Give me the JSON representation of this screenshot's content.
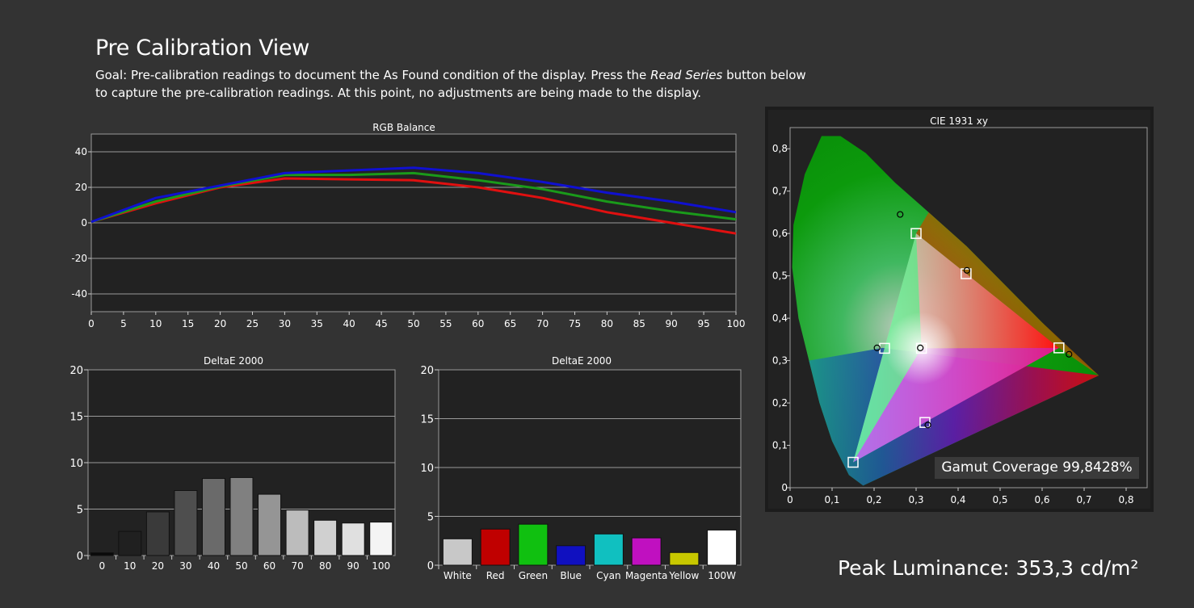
{
  "page": {
    "title": "Pre Calibration View",
    "goal_prefix": "Goal: Pre-calibration readings to document the As Found condition of the display. Press the ",
    "goal_emphasis": "Read Series",
    "goal_suffix": " button below to capture the pre-calibration readings. At this point, no adjustments are being made to the display.",
    "peak_luminance": "Peak Luminance: 353,3 cd/m²",
    "gamut_coverage": "Gamut Coverage 99,8428%"
  },
  "colors": {
    "background": "#333333",
    "plot_bg": "#222222",
    "red": "#e01010",
    "green": "#1a9a1a",
    "blue": "#1010d0"
  },
  "chart_data": [
    {
      "type": "line",
      "title": "RGB Balance",
      "x": [
        0,
        10,
        20,
        30,
        40,
        50,
        60,
        70,
        80,
        90,
        100
      ],
      "xticks": [
        "0",
        "5",
        "10",
        "15",
        "20",
        "25",
        "30",
        "35",
        "40",
        "45",
        "50",
        "55",
        "60",
        "65",
        "70",
        "75",
        "80",
        "85",
        "90",
        "95",
        "100"
      ],
      "yticks": [
        "40",
        "20",
        "0",
        "-20",
        "-40"
      ],
      "ylim": [
        -50,
        50
      ],
      "xlim": [
        0,
        100
      ],
      "grid": true,
      "series": [
        {
          "color": "#e01010",
          "values": [
            0.5,
            11,
            20,
            25,
            24.5,
            24,
            20,
            14,
            6,
            0,
            -6
          ]
        },
        {
          "color": "#1a9a1a",
          "values": [
            0.5,
            12,
            20.5,
            27,
            27,
            28,
            24,
            19,
            12,
            6.5,
            2
          ]
        },
        {
          "color": "#1010d0",
          "values": [
            0.5,
            14,
            21,
            28,
            29.5,
            31,
            28,
            23,
            17,
            12,
            6
          ]
        }
      ]
    },
    {
      "type": "bar",
      "title": "DeltaE 2000",
      "categories": [
        "0",
        "10",
        "20",
        "30",
        "40",
        "50",
        "60",
        "70",
        "80",
        "90",
        "100"
      ],
      "values": [
        0.3,
        2.6,
        4.7,
        7.0,
        8.3,
        8.4,
        6.6,
        4.9,
        3.8,
        3.5,
        3.6
      ],
      "colors": [
        "#0a0a0a",
        "#202020",
        "#3a3a3a",
        "#4e4e4e",
        "#6a6a6a",
        "#808080",
        "#959595",
        "#bcbcbc",
        "#d0d0d0",
        "#e0e0e0",
        "#f4f4f4"
      ],
      "yticks": [
        "20",
        "15",
        "10",
        "5",
        "0"
      ],
      "ylim": [
        0,
        20
      ],
      "grid": true
    },
    {
      "type": "bar",
      "title": "DeltaE 2000",
      "categories": [
        "White",
        "Red",
        "Green",
        "Blue",
        "Cyan",
        "Magenta",
        "Yellow",
        "100W"
      ],
      "values": [
        2.7,
        3.7,
        4.2,
        2.0,
        3.2,
        2.8,
        1.3,
        3.6
      ],
      "colors": [
        "#c8c8c8",
        "#c00000",
        "#10c010",
        "#1010c0",
        "#10c0c0",
        "#c010c0",
        "#c8c800",
        "#ffffff"
      ],
      "yticks": [
        "20",
        "15",
        "10",
        "5",
        "0"
      ],
      "ylim": [
        0,
        20
      ],
      "grid": true
    },
    {
      "type": "scatter",
      "title": "CIE 1931 xy",
      "xlim": [
        0,
        0.85
      ],
      "ylim": [
        0,
        0.85
      ],
      "xticks": [
        "0",
        "0,1",
        "0,2",
        "0,3",
        "0,4",
        "0,5",
        "0,6",
        "0,7",
        "0,8"
      ],
      "yticks": [
        "0",
        "0,1",
        "0,2",
        "0,3",
        "0,4",
        "0,5",
        "0,6",
        "0,7",
        "0,8"
      ],
      "target_gamut": {
        "red": [
          0.64,
          0.33
        ],
        "green": [
          0.3,
          0.6
        ],
        "blue": [
          0.15,
          0.06
        ]
      },
      "targets": [
        [
          0.64,
          0.33
        ],
        [
          0.3,
          0.6
        ],
        [
          0.15,
          0.06
        ],
        [
          0.225,
          0.329
        ],
        [
          0.321,
          0.154
        ],
        [
          0.419,
          0.505
        ],
        [
          0.3127,
          0.329
        ]
      ],
      "measured": [
        [
          0.664,
          0.315
        ],
        [
          0.262,
          0.645
        ],
        [
          0.207,
          0.33
        ],
        [
          0.328,
          0.148
        ],
        [
          0.421,
          0.513
        ],
        [
          0.31,
          0.33
        ]
      ]
    }
  ]
}
